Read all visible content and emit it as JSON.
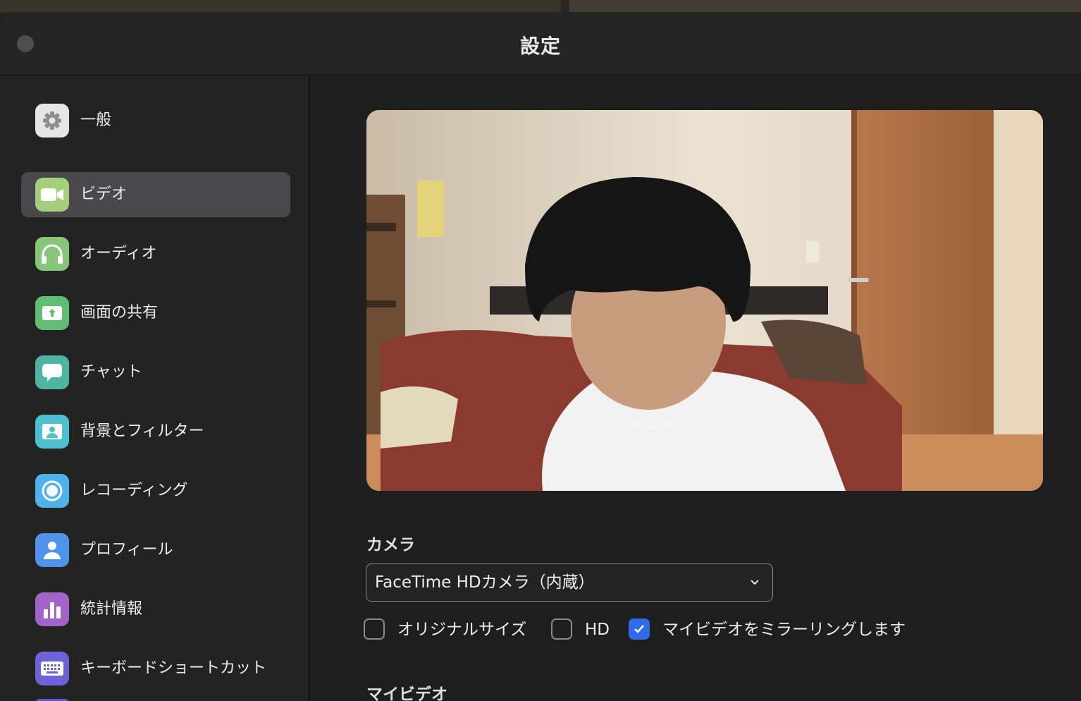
{
  "window": {
    "title": "設定"
  },
  "sidebar": {
    "items": [
      {
        "label": "一般",
        "icon": "gear-icon",
        "color": "#e6e6e6"
      },
      {
        "label": "ビデオ",
        "icon": "video-camera-icon",
        "color": "#a4d07d",
        "active": true
      },
      {
        "label": "オーディオ",
        "icon": "headphones-icon",
        "color": "#86c57a"
      },
      {
        "label": "画面の共有",
        "icon": "share-screen-icon",
        "color": "#5fbe74"
      },
      {
        "label": "チャット",
        "icon": "chat-bubble-icon",
        "color": "#4fb4a2"
      },
      {
        "label": "背景とフィルター",
        "icon": "background-portrait-icon",
        "color": "#4fc0cf"
      },
      {
        "label": "レコーディング",
        "icon": "record-icon",
        "color": "#4fb2ea"
      },
      {
        "label": "プロフィール",
        "icon": "profile-icon",
        "color": "#4d94ea"
      },
      {
        "label": "統計情報",
        "icon": "statistics-icon",
        "color": "#a463c9"
      },
      {
        "label": "キーボードショートカット",
        "icon": "keyboard-icon",
        "color": "#6d63d6"
      }
    ]
  },
  "video": {
    "camera_label": "カメラ",
    "camera_value": "FaceTime HDカメラ（内蔵）",
    "options": [
      {
        "label": "オリジナルサイズ",
        "checked": false
      },
      {
        "label": "HD",
        "checked": false
      },
      {
        "label": "マイビデオをミラーリングします",
        "checked": true
      }
    ],
    "my_video_label": "マイビデオ"
  },
  "colors": {
    "accent": "#2f6be6",
    "window_bg": "#232323",
    "active_item": "#48484d"
  }
}
